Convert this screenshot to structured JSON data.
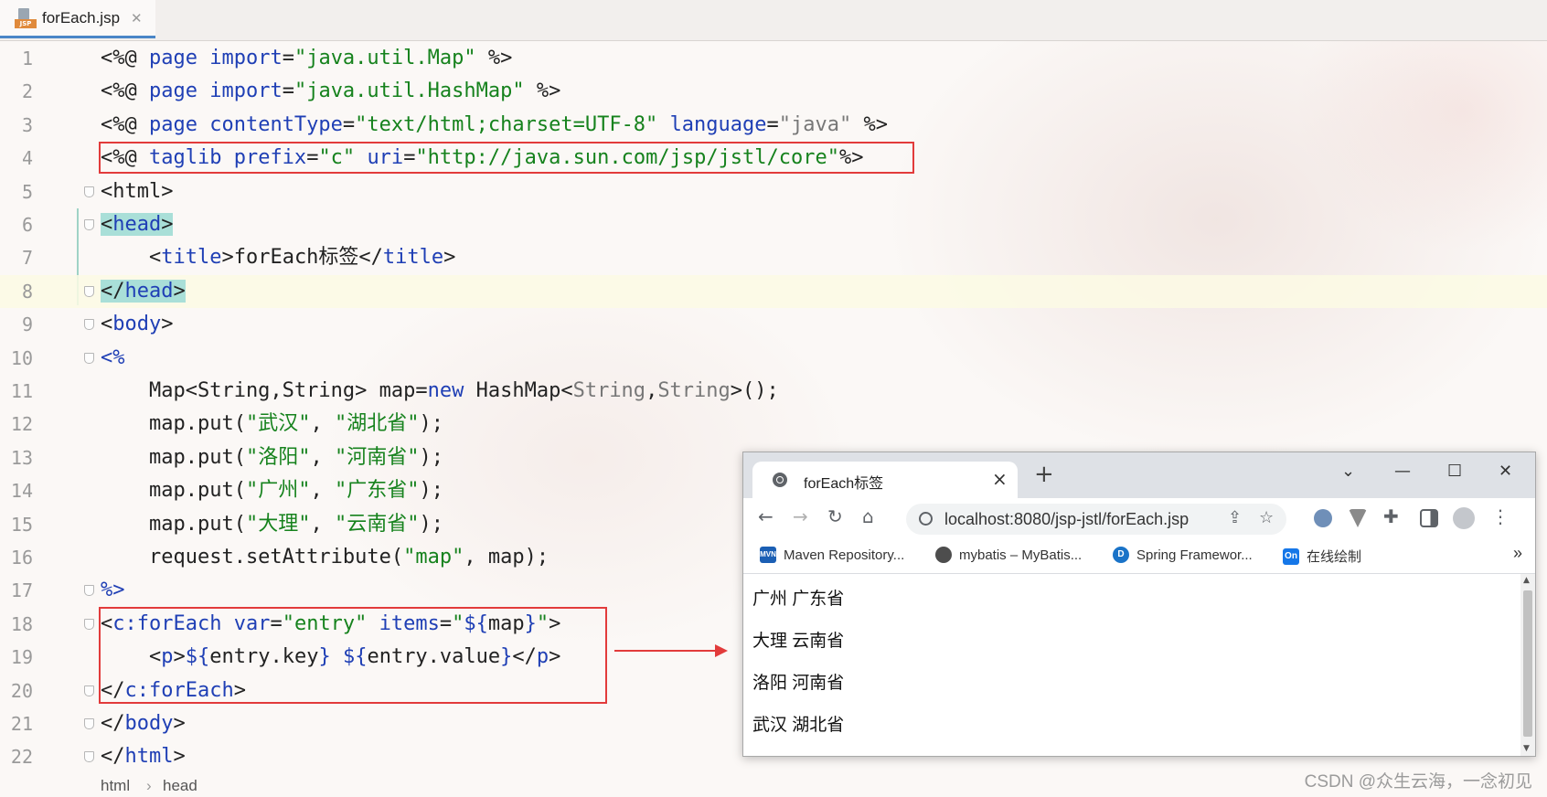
{
  "editor": {
    "tab": {
      "label": "forEach.jsp",
      "icon": "jsp-file-icon"
    },
    "lines": [
      {
        "n": "1",
        "segs": [
          [
            "t",
            "<%@ "
          ],
          [
            "k",
            "page "
          ],
          [
            "k",
            "import"
          ],
          [
            "t",
            "="
          ],
          [
            "s",
            "\"java.util.Map\""
          ],
          [
            "t",
            " %>"
          ]
        ]
      },
      {
        "n": "2",
        "segs": [
          [
            "t",
            "<%@ "
          ],
          [
            "k",
            "page "
          ],
          [
            "k",
            "import"
          ],
          [
            "t",
            "="
          ],
          [
            "s",
            "\"java.util.HashMap\""
          ],
          [
            "t",
            " %>"
          ]
        ]
      },
      {
        "n": "3",
        "segs": [
          [
            "t",
            "<%@ "
          ],
          [
            "k",
            "page "
          ],
          [
            "k",
            "contentType"
          ],
          [
            "t",
            "="
          ],
          [
            "s",
            "\"text/html;charset=UTF-8\""
          ],
          [
            "t",
            " "
          ],
          [
            "k",
            "language"
          ],
          [
            "t",
            "="
          ],
          [
            "g",
            "\"java\""
          ],
          [
            "t",
            " %>"
          ]
        ]
      },
      {
        "n": "4",
        "segs": [
          [
            "t",
            "<%@ "
          ],
          [
            "k",
            "taglib "
          ],
          [
            "k",
            "prefix"
          ],
          [
            "t",
            "="
          ],
          [
            "s",
            "\"c\""
          ],
          [
            "t",
            " "
          ],
          [
            "k",
            "uri"
          ],
          [
            "t",
            "="
          ],
          [
            "s",
            "\"http://java.sun.com/jsp/jstl/core\""
          ],
          [
            "t",
            "%>"
          ]
        ]
      },
      {
        "n": "5",
        "fold": true,
        "segs": [
          [
            "t",
            "<html>"
          ]
        ]
      },
      {
        "n": "6",
        "fold": true,
        "segs": [
          [
            "h",
            "<"
          ],
          [
            "hk",
            "head"
          ],
          [
            "h",
            ">"
          ]
        ]
      },
      {
        "n": "7",
        "segs": [
          [
            "t",
            "    <"
          ],
          [
            "k",
            "title"
          ],
          [
            "t",
            ">forEach标签</"
          ],
          [
            "k",
            "title"
          ],
          [
            "t",
            ">"
          ]
        ]
      },
      {
        "n": "8",
        "fold": true,
        "current": true,
        "segs": [
          [
            "h",
            "</"
          ],
          [
            "hk",
            "head"
          ],
          [
            "h",
            ">"
          ]
        ]
      },
      {
        "n": "9",
        "fold": true,
        "segs": [
          [
            "t",
            "<"
          ],
          [
            "k",
            "body"
          ],
          [
            "t",
            ">"
          ]
        ]
      },
      {
        "n": "10",
        "fold": true,
        "segs": [
          [
            "k",
            "<%"
          ]
        ]
      },
      {
        "n": "11",
        "segs": [
          [
            "t",
            "    Map<String,String> map="
          ],
          [
            "k",
            "new "
          ],
          [
            "t",
            "HashMap<"
          ],
          [
            "g",
            "String"
          ],
          [
            "t",
            ","
          ],
          [
            "g",
            "String"
          ],
          [
            "t",
            ">();"
          ]
        ]
      },
      {
        "n": "12",
        "segs": [
          [
            "t",
            "    map.put("
          ],
          [
            "s",
            "\"武汉\""
          ],
          [
            "t",
            ", "
          ],
          [
            "s",
            "\"湖北省\""
          ],
          [
            "t",
            ");"
          ]
        ]
      },
      {
        "n": "13",
        "segs": [
          [
            "t",
            "    map.put("
          ],
          [
            "s",
            "\"洛阳\""
          ],
          [
            "t",
            ", "
          ],
          [
            "s",
            "\"河南省\""
          ],
          [
            "t",
            ");"
          ]
        ]
      },
      {
        "n": "14",
        "segs": [
          [
            "t",
            "    map.put("
          ],
          [
            "s",
            "\"广州\""
          ],
          [
            "t",
            ", "
          ],
          [
            "s",
            "\"广东省\""
          ],
          [
            "t",
            ");"
          ]
        ]
      },
      {
        "n": "15",
        "segs": [
          [
            "t",
            "    map.put("
          ],
          [
            "s",
            "\"大理\""
          ],
          [
            "t",
            ", "
          ],
          [
            "s",
            "\"云南省\""
          ],
          [
            "t",
            ");"
          ]
        ]
      },
      {
        "n": "16",
        "segs": [
          [
            "t",
            "    request.setAttribute("
          ],
          [
            "s",
            "\"map\""
          ],
          [
            "t",
            ", map);"
          ]
        ]
      },
      {
        "n": "17",
        "fold": true,
        "segs": [
          [
            "k",
            "%>"
          ]
        ]
      },
      {
        "n": "18",
        "fold": true,
        "segs": [
          [
            "t",
            "<"
          ],
          [
            "k",
            "c:forEach "
          ],
          [
            "k",
            "var"
          ],
          [
            "t",
            "="
          ],
          [
            "s",
            "\"entry\""
          ],
          [
            "t",
            " "
          ],
          [
            "k",
            "items"
          ],
          [
            "t",
            "="
          ],
          [
            "s",
            "\""
          ],
          [
            "k",
            "${"
          ],
          [
            "t",
            "map"
          ],
          [
            "k",
            "}"
          ],
          [
            "s",
            "\""
          ],
          [
            "t",
            ">"
          ]
        ]
      },
      {
        "n": "19",
        "segs": [
          [
            "t",
            "    <"
          ],
          [
            "k",
            "p"
          ],
          [
            "t",
            ">"
          ],
          [
            "k",
            "${"
          ],
          [
            "t",
            "entry.key"
          ],
          [
            "k",
            "}"
          ],
          [
            "t",
            " "
          ],
          [
            "k",
            "${"
          ],
          [
            "t",
            "entry.value"
          ],
          [
            "k",
            "}"
          ],
          [
            "t",
            "</"
          ],
          [
            "k",
            "p"
          ],
          [
            "t",
            ">"
          ]
        ]
      },
      {
        "n": "20",
        "fold": true,
        "segs": [
          [
            "t",
            "</"
          ],
          [
            "k",
            "c:forEach"
          ],
          [
            "t",
            ">"
          ]
        ]
      },
      {
        "n": "21",
        "fold": true,
        "segs": [
          [
            "t",
            "</"
          ],
          [
            "k",
            "body"
          ],
          [
            "t",
            ">"
          ]
        ]
      },
      {
        "n": "22",
        "fold": true,
        "segs": [
          [
            "t",
            "</"
          ],
          [
            "k",
            "html"
          ],
          [
            "t",
            ">"
          ]
        ]
      }
    ],
    "breadcrumb": [
      "html",
      "head"
    ],
    "breadcrumb_sep": "›",
    "colors": {
      "keyword": "#1f3fb5",
      "string": "#16821d",
      "annotation": "#e23b3b"
    }
  },
  "browser": {
    "tab_title": "forEach标签",
    "tab_close": "×",
    "new_tab": "+",
    "window_controls": {
      "dropdown": "⌄",
      "minimize": "—",
      "maximize": "☐",
      "close": "✕"
    },
    "nav": {
      "back": "←",
      "forward": "→",
      "reload": "↻",
      "home": "⌂"
    },
    "url": "localhost:8080/jsp-jstl/forEach.jsp",
    "bookmarks": [
      {
        "label": "Maven Repository...",
        "icon_text": "MVN",
        "color": "#1b5fb4"
      },
      {
        "label": "mybatis – MyBatis...",
        "icon_text": "",
        "color": "#4d4d4d"
      },
      {
        "label": "Spring Framewor...",
        "icon_text": "D",
        "color": "#1a73c8"
      },
      {
        "label": "在线绘制",
        "icon_text": "On",
        "color": "#1677e8"
      }
    ],
    "bookmarks_more": "»",
    "entries": [
      "广州 广东省",
      "大理 云南省",
      "洛阳 河南省",
      "武汉 湖北省"
    ]
  },
  "watermark": "CSDN @众生云海，一念初见"
}
